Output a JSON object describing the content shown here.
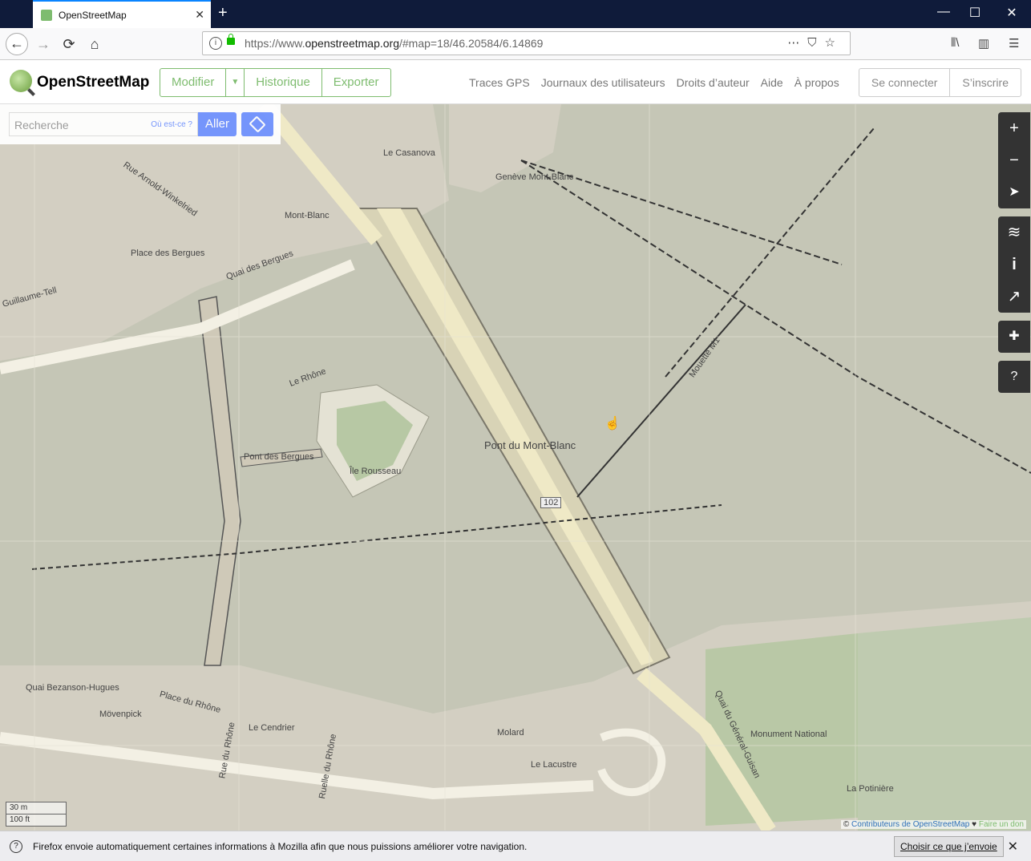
{
  "browser": {
    "tab_title": "OpenStreetMap",
    "url_prefix": "https://www.",
    "url_host": "openstreetmap.org",
    "url_path": "/#map=18/46.20584/6.14869",
    "new_tab_symbol": "+",
    "tab_close_symbol": "✕",
    "window_controls": {
      "minimize": "—",
      "maximize": "☐",
      "close": "✕"
    }
  },
  "header": {
    "logo_text": "OpenStreetMap",
    "edit_label": "Modifier",
    "history_label": "Historique",
    "export_label": "Exporter",
    "nav_links": [
      "Traces GPS",
      "Journaux des utilisateurs",
      "Droits d’auteur",
      "Aide",
      "À propos"
    ],
    "login_label": "Se connecter",
    "signup_label": "S’inscrire"
  },
  "search": {
    "placeholder": "Recherche",
    "where_label": "Où est-ce ?",
    "go_label": "Aller"
  },
  "map_controls": {
    "zoom_in": "+",
    "zoom_out": "−",
    "locate": "➤",
    "layers": "≋",
    "info": "i",
    "share": "↗",
    "note": "✚",
    "query": "?"
  },
  "map": {
    "labels": [
      "Le Casanova",
      "Genève Mont-Blanc",
      "Mont-Blanc",
      "Rue Arnold-Winkelried",
      "Place des Bergues",
      "Quai des Bergues",
      "Guillaume-Tell",
      "Le Rhône",
      "Pont des Bergues",
      "Île Rousseau",
      "Pont du Mont-Blanc",
      "Mouette M1",
      "102",
      "Quai Bezanson-Hugues",
      "Place du Rhône",
      "Mövenpick",
      "Molard",
      "Le Lacustre",
      "Monument National",
      "Quai du Général-Guisan",
      "La Potinière",
      "Le Cendrier",
      "Ruelle du Rhône",
      "Rue du Rhône"
    ],
    "scale_metric": "30 m",
    "scale_imperial": "100 ft",
    "attribution_prefix": "© ",
    "attribution_link": "Contributeurs de OpenStreetMap",
    "attribution_heart": " ♥ ",
    "attribution_donate": "Faire un don",
    "colors": {
      "water": "#c5c6b6",
      "land": "#d6d3c6",
      "park": "#b7c9a6",
      "bridge": "#d8d3b8"
    }
  },
  "notification": {
    "text": "Firefox envoie automatiquement certaines informations à Mozilla afin que nous puissions améliorer votre navigation.",
    "button_label": "Choisir ce que j’envoie",
    "close": "✕",
    "icon": "?"
  }
}
